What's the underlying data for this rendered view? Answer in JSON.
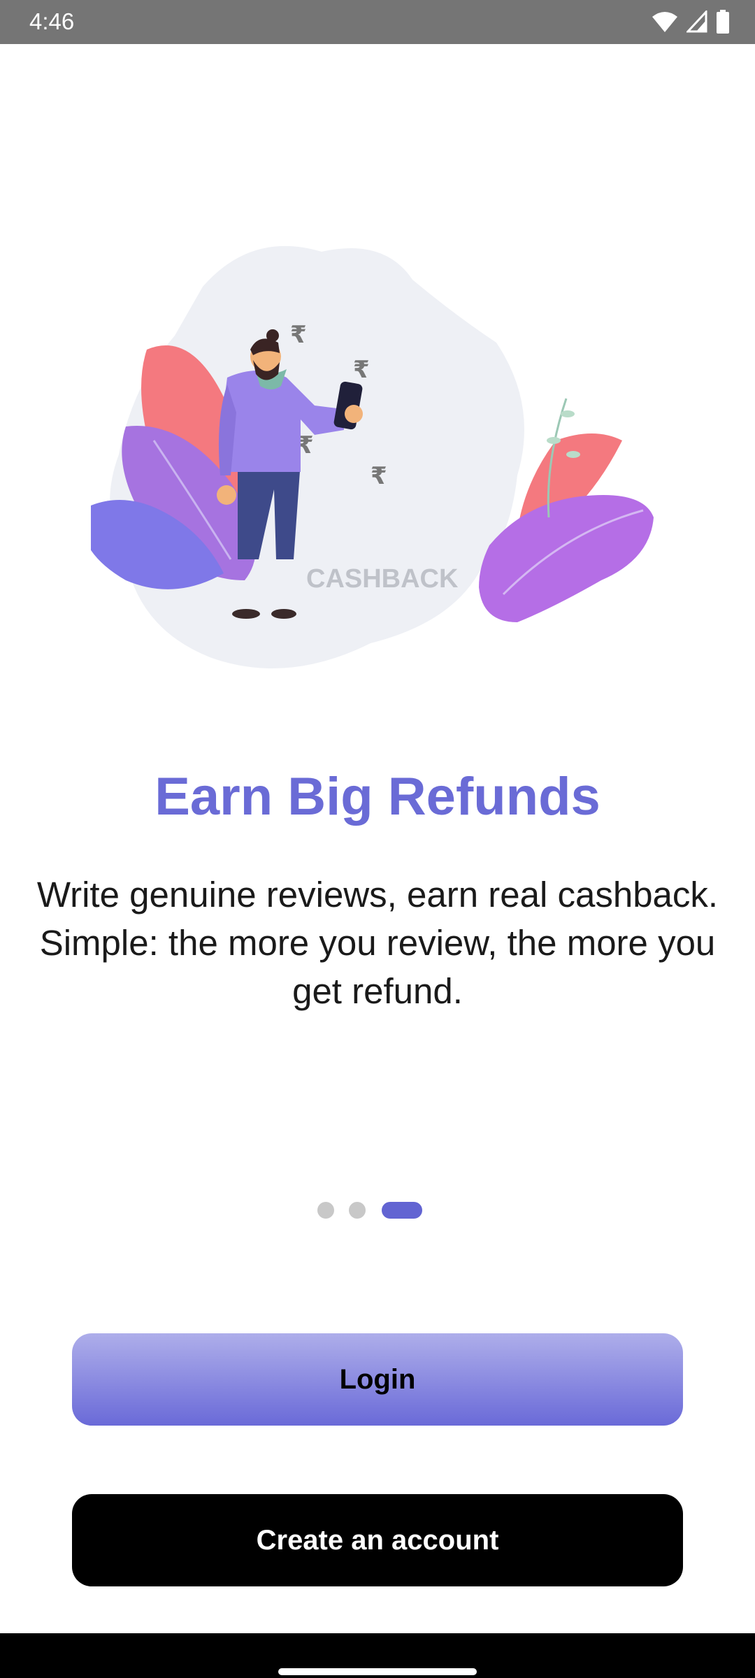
{
  "status_bar": {
    "time": "4:46"
  },
  "illustration": {
    "caption": "CASHBACK",
    "currency_symbol": "₹"
  },
  "onboarding": {
    "title": "Earn Big Refunds",
    "description": "Write genuine reviews, earn real cashback. Simple: the more you review, the more you get refund.",
    "page_indicator": {
      "total": 3,
      "active_index": 2
    }
  },
  "actions": {
    "login_label": "Login",
    "create_account_label": "Create an account"
  },
  "colors": {
    "accent": "#6a6bd6",
    "login_gradient_top": "#aeaeea",
    "login_gradient_bottom": "#6a6ad8",
    "create_button": "#000000",
    "status_bar": "#757575"
  }
}
